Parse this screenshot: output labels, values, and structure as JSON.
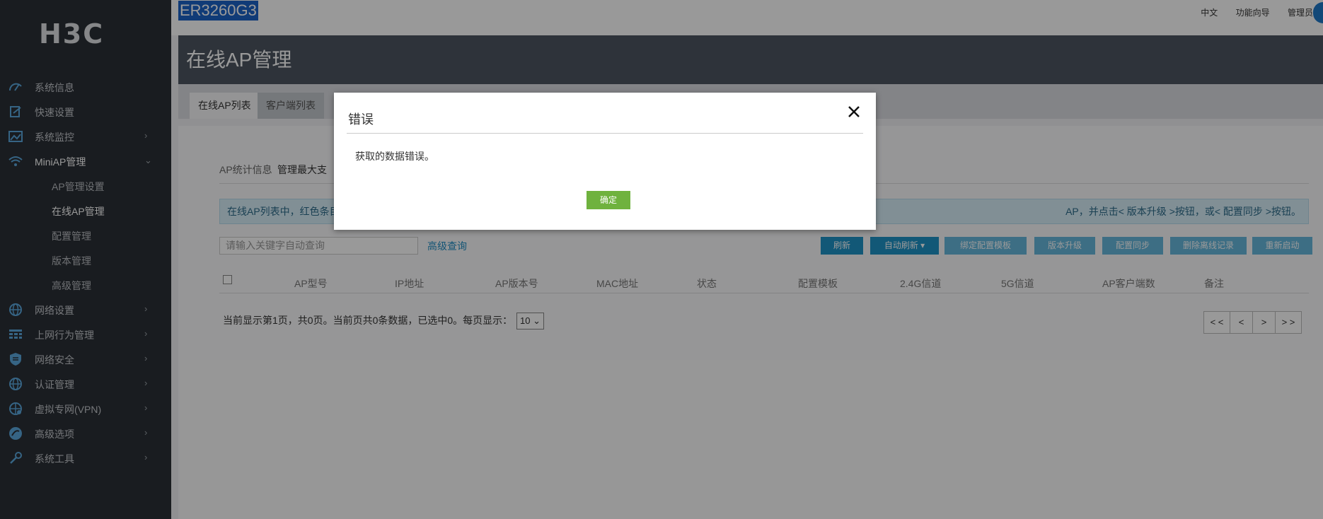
{
  "brand": {
    "logo_text": "H3C",
    "model": "ER3260G3"
  },
  "topbar": {
    "links": [
      "中文",
      "功能向导",
      "管理员"
    ]
  },
  "sidebar": {
    "items": [
      {
        "label": "系统信息",
        "icon": "gauge-icon"
      },
      {
        "label": "快速设置",
        "icon": "quick-setup-icon"
      },
      {
        "label": "系统监控",
        "icon": "monitor-icon"
      },
      {
        "label": "MiniAP管理",
        "icon": "wifi-icon"
      },
      {
        "label": "网络设置",
        "icon": "globe-icon"
      },
      {
        "label": "上网行为管理",
        "icon": "grid-icon"
      },
      {
        "label": "网络安全",
        "icon": "shield-icon"
      },
      {
        "label": "认证管理",
        "icon": "globe-icon"
      },
      {
        "label": "虚拟专网(VPN)",
        "icon": "vpn-globe-icon"
      },
      {
        "label": "高级选项",
        "icon": "advanced-icon"
      },
      {
        "label": "系统工具",
        "icon": "tools-icon"
      }
    ],
    "subitems": [
      "AP管理设置",
      "在线AP管理",
      "配置管理",
      "版本管理",
      "高级管理"
    ]
  },
  "page": {
    "title": "在线AP管理"
  },
  "tabs": [
    "在线AP列表",
    "客户端列表"
  ],
  "stats": {
    "label1": "AP统计信息",
    "label2": "管理最大支"
  },
  "notice": {
    "left": "在线AP列表中，红色条目",
    "right": "AP，并点击< 版本升级 >按钮，或< 配置同步 >按钮。"
  },
  "search": {
    "placeholder": "请输入关键字自动查询",
    "advanced": "高级查询"
  },
  "toolbar": [
    "刷新",
    "自动刷新 ▾",
    "绑定配置模板",
    "版本升级",
    "配置同步",
    "删除离线记录",
    "重新启动"
  ],
  "table": {
    "headers": [
      "AP型号",
      "IP地址",
      "AP版本号",
      "MAC地址",
      "状态",
      "配置模板",
      "2.4G信道",
      "5G信道",
      "AP客户端数",
      "备注"
    ]
  },
  "pagination": {
    "info": "当前显示第1页，共0页。当前页共0条数据，已选中0。每页显示：",
    "per_page": "10 ⌄",
    "buttons": [
      "< <",
      "<",
      ">",
      "> >"
    ]
  },
  "dialog": {
    "title": "错误",
    "message": "获取的数据错误。",
    "ok_label": "确定"
  }
}
